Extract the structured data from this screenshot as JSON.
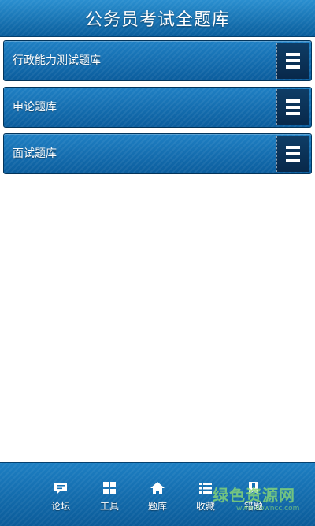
{
  "header": {
    "title": "公务员考试全题库"
  },
  "list": {
    "items": [
      {
        "label": "行政能力测试题库",
        "icon": "menu-icon"
      },
      {
        "label": "申论题库",
        "icon": "menu-icon"
      },
      {
        "label": "面试题库",
        "icon": "menu-icon"
      }
    ]
  },
  "tabbar": {
    "tabs": [
      {
        "label": "论坛",
        "icon": "chat-bubble-icon"
      },
      {
        "label": "工具",
        "icon": "grid-icon"
      },
      {
        "label": "题库",
        "icon": "home-icon"
      },
      {
        "label": "收藏",
        "icon": "list-icon"
      },
      {
        "label": "错题",
        "icon": "bookmark-icon"
      }
    ]
  },
  "watermark": {
    "text": "绿色资源网",
    "url": "www.downcc.com"
  },
  "colors": {
    "primary": "#0b5d9d",
    "primary_light": "#1f80c4",
    "button_dark": "#08284a"
  }
}
